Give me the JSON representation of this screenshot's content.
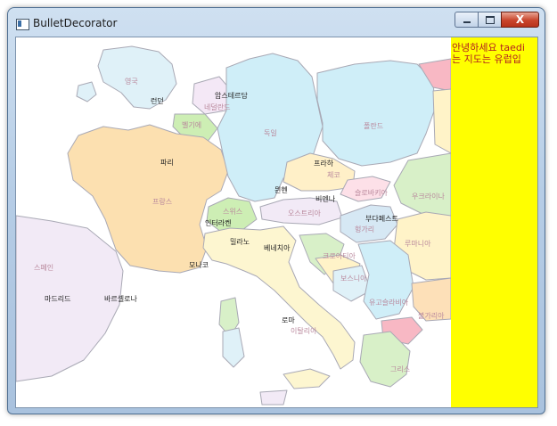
{
  "window": {
    "title": "BulletDecorator",
    "close_glyph": "X"
  },
  "map": {
    "labels": {
      "uk": "영국",
      "london": "런던",
      "amsterdam": "암스테르담",
      "netherlands": "네덜란드",
      "belgium": "벨기에",
      "germany": "독일",
      "poland": "폴란드",
      "paris": "파리",
      "prague": "프라하",
      "czech": "체코",
      "slovakia": "슬로바키아",
      "ukraine": "우크라이나",
      "france": "프랑스",
      "munich": "뮌헨",
      "vienna": "비엔나",
      "switzerland": "스위스",
      "austria": "오스트리아",
      "budapest": "부다페스트",
      "interlaken": "인터라켄",
      "hungary": "헝가리",
      "milan": "밀라노",
      "venice": "베네치아",
      "romania": "루마니아",
      "croatia": "크로아티아",
      "monaco": "모나코",
      "spain": "스페인",
      "bosnia": "보스니아",
      "madrid": "마드리드",
      "barcelona": "바르셀로나",
      "yugoslavia": "유고슬라비아",
      "bulgaria": "불가리아",
      "rome": "로마",
      "italy": "이탈리아",
      "greece": "그리스"
    }
  },
  "side_text": "안녕하세요 taedi\n는 지도는 유럽입"
}
